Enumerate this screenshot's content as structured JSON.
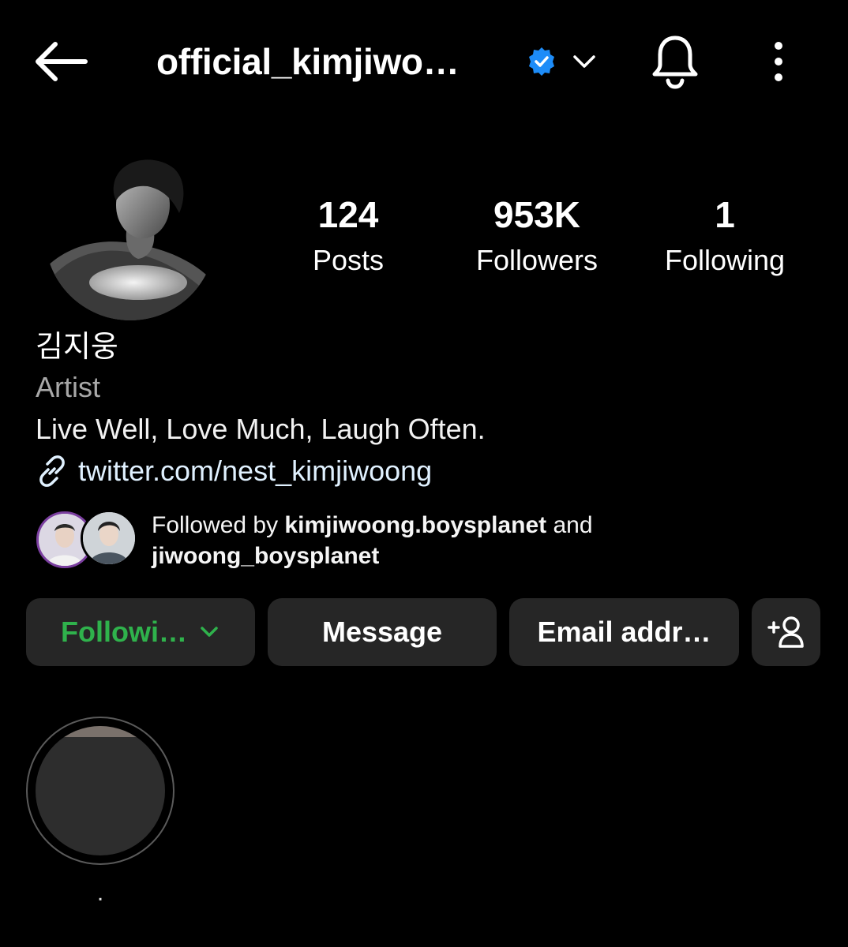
{
  "header": {
    "username": "official_kimjiwo…",
    "verified": true,
    "icons": {
      "back": "back-arrow-icon",
      "verified": "verified-badge-icon",
      "switch": "chevron-down-icon",
      "notifications": "bell-icon",
      "more": "more-vertical-icon"
    }
  },
  "stats": [
    {
      "value": "124",
      "label": "Posts"
    },
    {
      "value": "953K",
      "label": "Followers"
    },
    {
      "value": "1",
      "label": "Following"
    }
  ],
  "profile": {
    "display_name": "김지웅",
    "category": "Artist",
    "bio": "Live Well, Love Much, Laugh Often.",
    "link": "twitter.com/nest_kimjiwoong"
  },
  "followed_by": {
    "prefix": "Followed by ",
    "user1": "kimjiwoong.boysplanet",
    "conjunction": " and",
    "user2": "jiwoong_boysplanet"
  },
  "actions": {
    "following": "Followi…",
    "message": "Message",
    "email": "Email addr…"
  },
  "highlights": [
    {
      "label": "."
    }
  ],
  "colors": {
    "background": "#000000",
    "button_bg": "#262626",
    "following_green": "#2fb24c",
    "verified_blue": "#1d8cf8",
    "secondary_text": "#a8a8a8",
    "link_text": "#e0f1ff"
  }
}
